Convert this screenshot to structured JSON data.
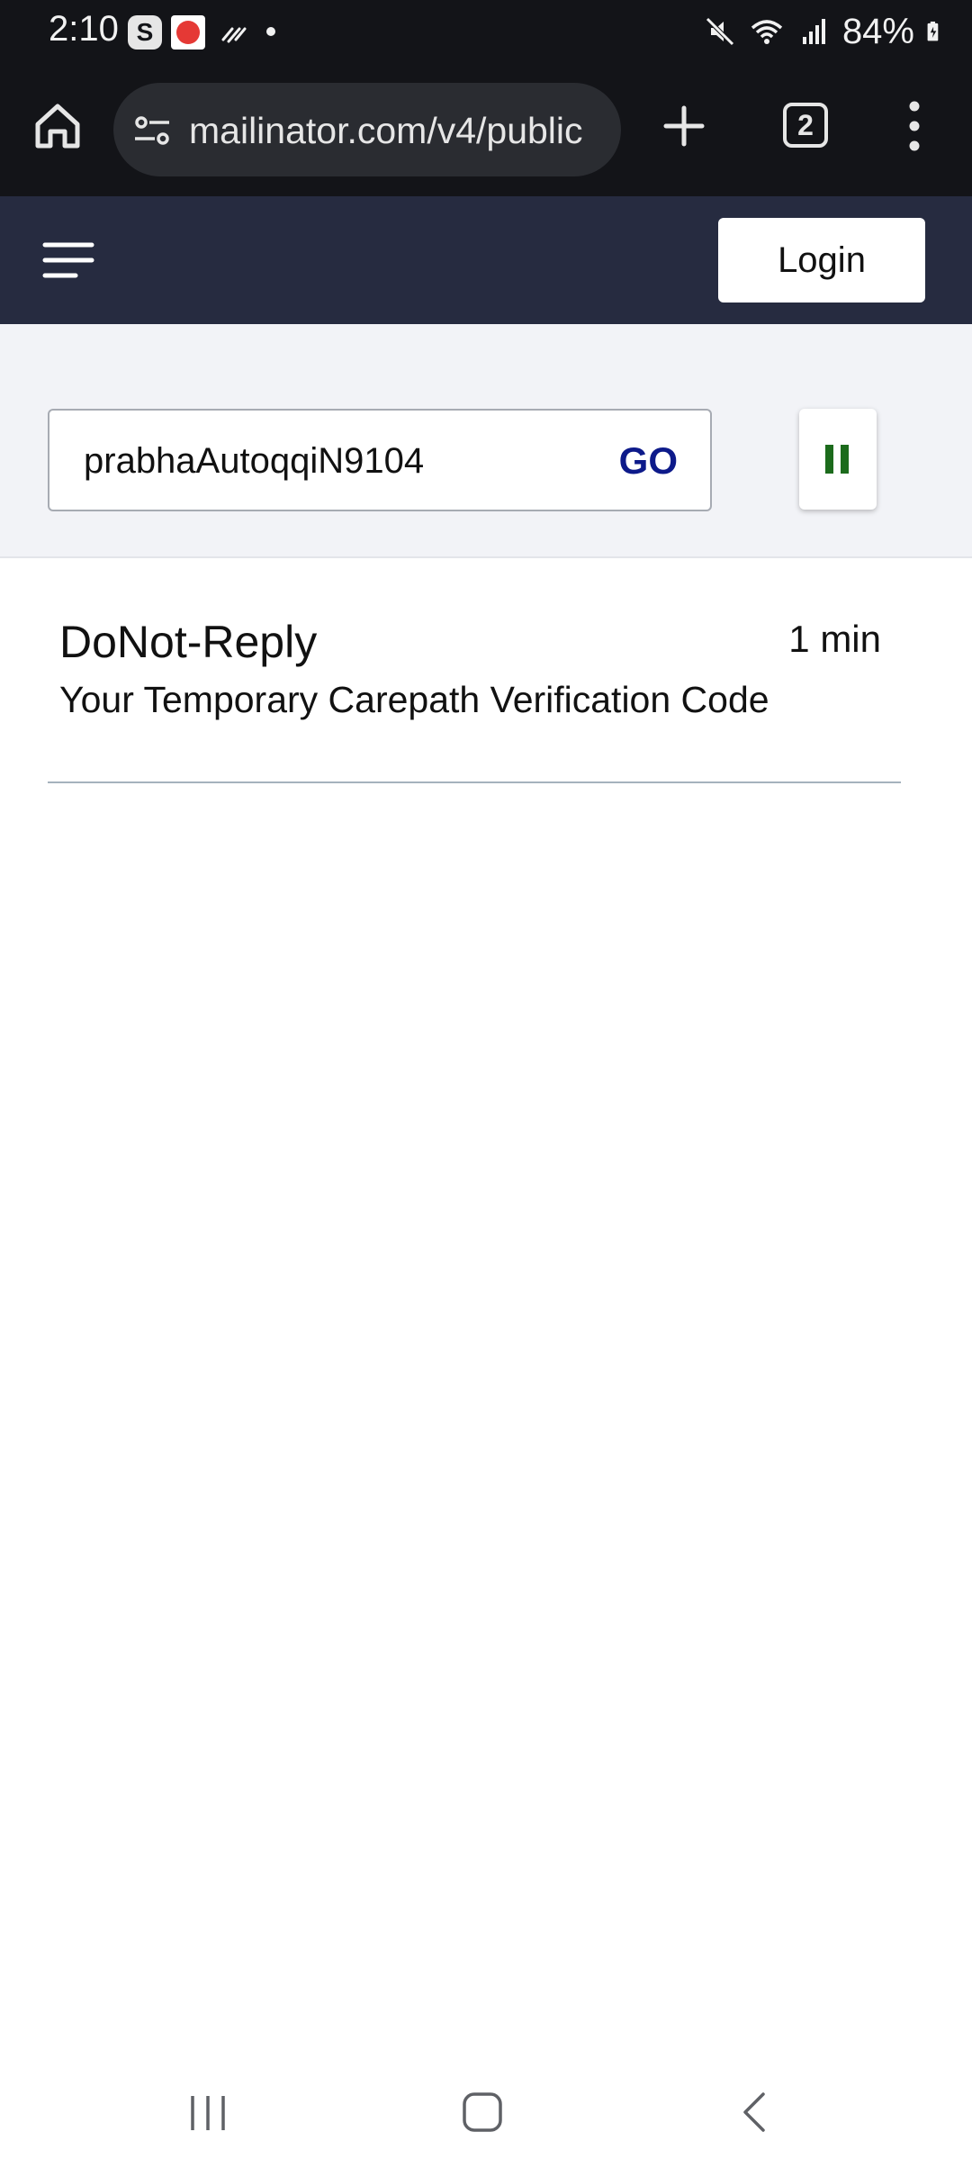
{
  "status_bar": {
    "time": "2:10",
    "s_badge": "S",
    "battery": "84%",
    "icons": [
      "skype-icon",
      "app-notification-icon",
      "flash-icon",
      "dot-icon",
      "mute-icon",
      "wifi-icon",
      "signal-icon",
      "battery-charging-icon"
    ]
  },
  "browser": {
    "url": "mailinator.com/v4/public",
    "tab_count": "2",
    "icons": [
      "home-icon",
      "site-settings-icon",
      "plus-icon",
      "tab-switcher-icon",
      "more-vert-icon"
    ]
  },
  "header": {
    "login_label": "Login",
    "menu_icon": "hamburger-icon",
    "background": "#262b40"
  },
  "search": {
    "inbox_value": "prabhaAutoqqiN9104",
    "go_label": "GO",
    "go_color": "#0d1a8a",
    "pause_icon": "pause-icon",
    "pause_color": "#1c6b1c"
  },
  "messages": [
    {
      "from": "DoNot-Reply",
      "time": "1 min",
      "subject": "Your Temporary Carepath Verification Code"
    }
  ],
  "nav_bar": {
    "icons": [
      "recent-apps-icon",
      "home-nav-icon",
      "back-nav-icon"
    ]
  }
}
